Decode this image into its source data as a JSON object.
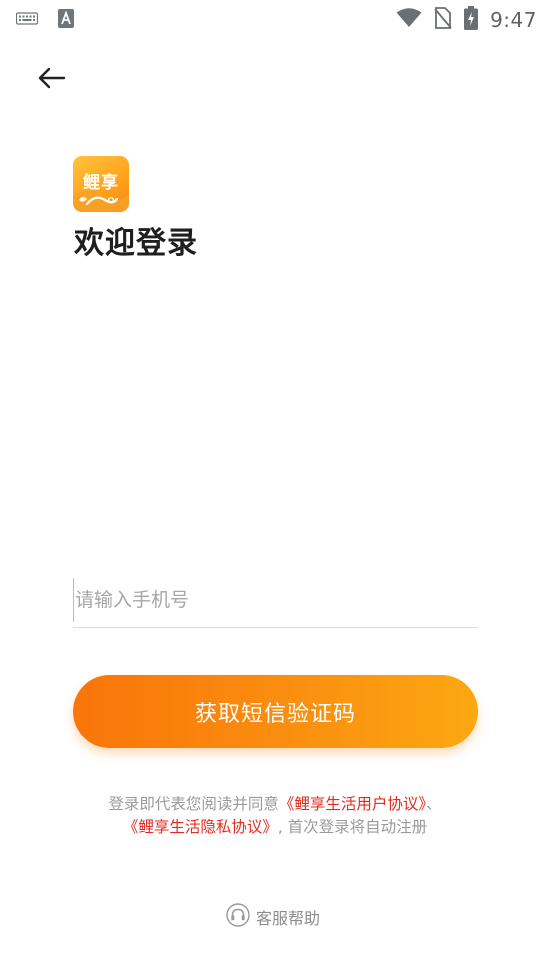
{
  "status_bar": {
    "time": "9:47",
    "icons": [
      "keyboard-icon",
      "text-input-icon",
      "wifi-icon",
      "no-sim-icon",
      "battery-charging-icon"
    ]
  },
  "nav": {
    "back_icon": "arrow-left-icon"
  },
  "logo": {
    "text": "鲤享"
  },
  "page": {
    "title": "欢迎登录"
  },
  "phone": {
    "placeholder": "请输入手机号",
    "value": ""
  },
  "actions": {
    "get_code_label": "获取短信验证码"
  },
  "agreement": {
    "prefix": "登录即代表您阅读并同意",
    "user_agreement": "《鲤享生活用户协议》",
    "separator": "、",
    "privacy_policy": "《鲤享生活隐私协议》",
    "suffix": ", 首次登录将自动注册"
  },
  "help": {
    "label": "客服帮助",
    "icon": "headset-icon"
  },
  "colors": {
    "accent_start": "#f97509",
    "accent_end": "#fca812",
    "link": "#e22c1f",
    "muted_text": "#9a9a9a"
  }
}
